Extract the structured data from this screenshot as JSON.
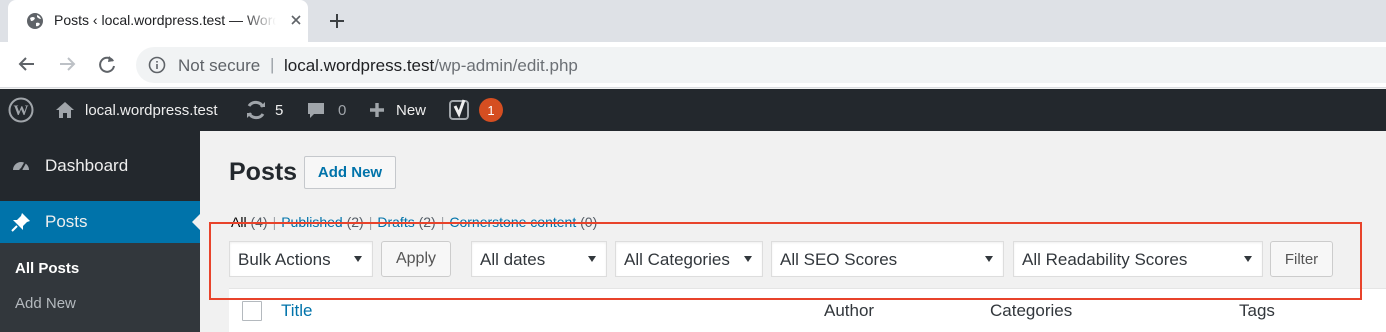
{
  "browser": {
    "tab_title": "Posts ‹ local.wordpress.test — WordPress",
    "address": {
      "security_label": "Not secure",
      "separator": "|",
      "host": "local.wordpress.test",
      "path": "/wp-admin/edit.php"
    }
  },
  "adminbar": {
    "site_name": "local.wordpress.test",
    "updates_count": "5",
    "comments_count": "0",
    "new_label": "New",
    "seo_badge": "1"
  },
  "sidebar": {
    "dashboard": "Dashboard",
    "posts": "Posts",
    "submenu": {
      "all_posts": "All Posts",
      "add_new": "Add New"
    }
  },
  "main": {
    "title": "Posts",
    "add_new_button": "Add New",
    "views": {
      "all": "All",
      "all_count": "(4)",
      "published": "Published",
      "published_count": "(2)",
      "drafts": "Drafts",
      "drafts_count": "(2)",
      "cornerstone": "Cornerstone content",
      "cornerstone_count": "(0)",
      "pipe": "|"
    },
    "filters": {
      "bulk_actions": "Bulk Actions",
      "apply": "Apply",
      "dates": "All dates",
      "categories": "All Categories",
      "seo_scores": "All SEO Scores",
      "readability_scores": "All Readability Scores",
      "filter": "Filter"
    },
    "table_columns": {
      "title": "Title",
      "author": "Author",
      "categories": "Categories",
      "tags": "Tags"
    }
  },
  "colors": {
    "accent": "#0073aa",
    "adminbar_bg": "#23282d",
    "highlight": "#e8432b",
    "badge": "#d54e21"
  }
}
